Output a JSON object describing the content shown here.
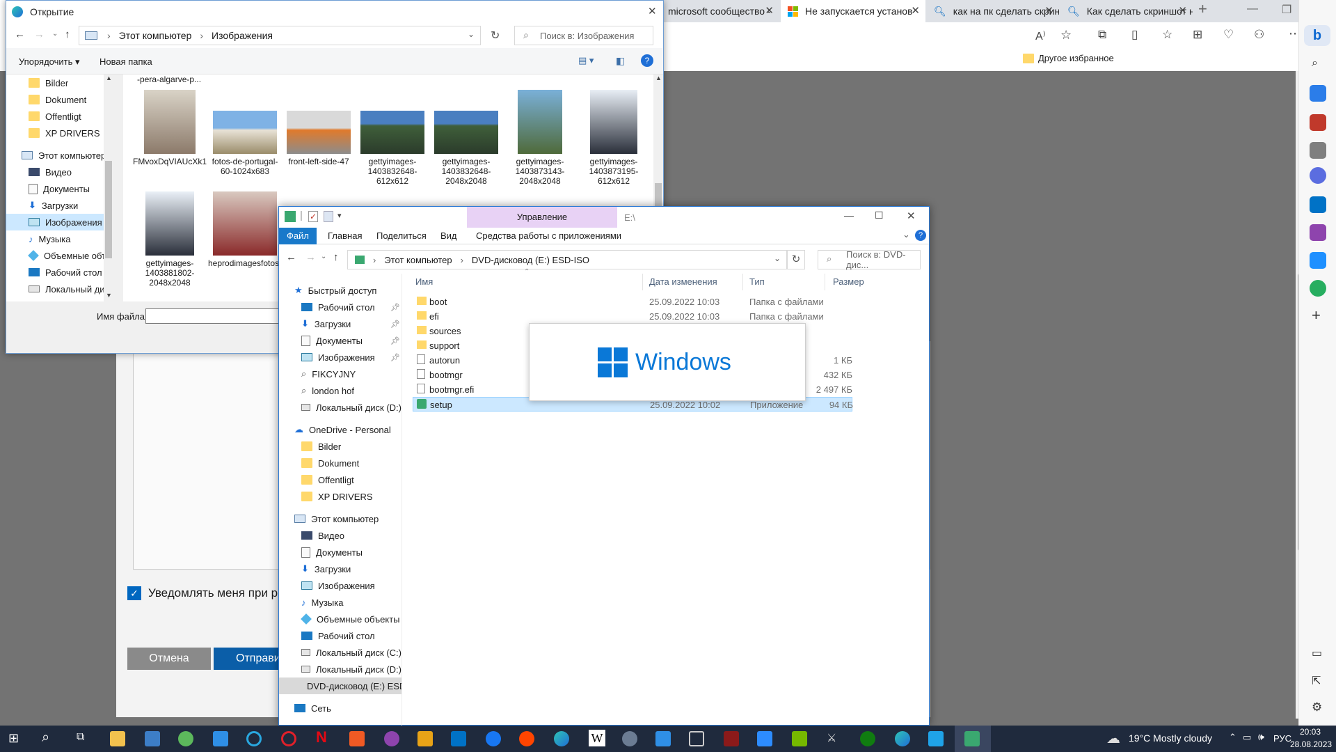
{
  "browser": {
    "tabs": [
      {
        "label": "microsoft сообщество -"
      },
      {
        "label": "Не запускается установ"
      },
      {
        "label": "как на пк сделать скрин"
      },
      {
        "label": "Как сделать скриншот н"
      }
    ],
    "favorites_label": "Другое избранное",
    "form": {
      "notify_label": "Уведомлять меня при раз",
      "cancel_label": "Отмена",
      "submit_label": "Отправи"
    }
  },
  "open_dialog": {
    "title": "Открытие",
    "breadcrumb": [
      "Этот компьютер",
      "Изображения"
    ],
    "search_placeholder": "Поиск в: Изображения",
    "organize_label": "Упорядочить",
    "new_folder_label": "Новая папка",
    "nav_items": [
      "Bilder",
      "Dokument",
      "Offentligt",
      "XP DRIVERS",
      "Этот компьютер",
      "Видео",
      "Документы",
      "Загрузки",
      "Изображения",
      "Музыка",
      "Объемные объ",
      "Рабочий стол",
      "Локальный дис"
    ],
    "partial_caption": "-pera-algarve-p...",
    "thumbnails": [
      {
        "caption": "FMvoxDqVIAUcXk1"
      },
      {
        "caption": "fotos-de-portugal-60-1024x683"
      },
      {
        "caption": "front-left-side-47"
      },
      {
        "caption": "gettyimages-1403832648-612x612"
      },
      {
        "caption": "gettyimages-1403832648-2048x2048"
      },
      {
        "caption": "gettyimages-1403873143-2048x2048"
      },
      {
        "caption": "gettyimages-1403873195-612x612"
      },
      {
        "caption": "gettyimages-1403881802-2048x2048"
      },
      {
        "caption": "heprodimagesfotos85120120725nemec1jpg"
      }
    ],
    "filename_label": "Имя файла:",
    "filename_value": ""
  },
  "explorer": {
    "ribbon_context": "Управление",
    "path_title": "E:\\",
    "ribbon_tabs": [
      "Файл",
      "Главная",
      "Поделиться",
      "Вид",
      "Средства работы с приложениями"
    ],
    "breadcrumb": [
      "Этот компьютер",
      "DVD-дисковод (E:) ESD-ISO"
    ],
    "search_placeholder": "Поиск в: DVD-дис...",
    "quick_access": [
      {
        "label": "Быстрый доступ"
      },
      {
        "label": "Рабочий стол"
      },
      {
        "label": "Загрузки"
      },
      {
        "label": "Документы"
      },
      {
        "label": "Изображения"
      },
      {
        "label": "FIKCYJNY"
      },
      {
        "label": "london hof"
      },
      {
        "label": "Локальный диск (D:)"
      }
    ],
    "onedrive": [
      "OneDrive - Personal",
      "Bilder",
      "Dokument",
      "Offentligt",
      "XP DRIVERS"
    ],
    "this_pc": [
      "Этот компьютер",
      "Видео",
      "Документы",
      "Загрузки",
      "Изображения",
      "Музыка",
      "Объемные объекты",
      "Рабочий стол",
      "Локальный диск (C:)",
      "Локальный диск (D:)",
      "DVD-дисковод (E:) ESD"
    ],
    "network": "Сеть",
    "columns": {
      "name": "Имя",
      "date": "Дата изменения",
      "type": "Тип",
      "size": "Размер"
    },
    "files": [
      {
        "name": "boot",
        "date": "25.09.2022 10:03",
        "type": "Папка с файлами",
        "size": ""
      },
      {
        "name": "efi",
        "date": "25.09.2022 10:03",
        "type": "Папка с файлами",
        "size": ""
      },
      {
        "name": "sources",
        "date": "",
        "type": "ми",
        "size": ""
      },
      {
        "name": "support",
        "date": "",
        "type": "ми",
        "size": ""
      },
      {
        "name": "autorun",
        "date": "",
        "type": "ст...",
        "size": "1 КБ"
      },
      {
        "name": "bootmgr",
        "date": "",
        "type": "",
        "size": "432 КБ"
      },
      {
        "name": "bootmgr.efi",
        "date": "",
        "type": "",
        "size": "2 497 КБ"
      },
      {
        "name": "setup",
        "date": "25.09.2022 10:02",
        "type": "Приложение",
        "size": "94 КБ"
      }
    ],
    "splash_text": "Windows"
  },
  "taskbar": {
    "weather": "19°C  Mostly cloudy",
    "lang": "РУС",
    "time": "20:03",
    "date": "28.08.2023"
  },
  "colors": {
    "accent": "#0067c0",
    "selection": "#cce8ff",
    "folder": "#ffd86b",
    "taskbar": "#1f2a3d",
    "backdrop": "#737373"
  }
}
